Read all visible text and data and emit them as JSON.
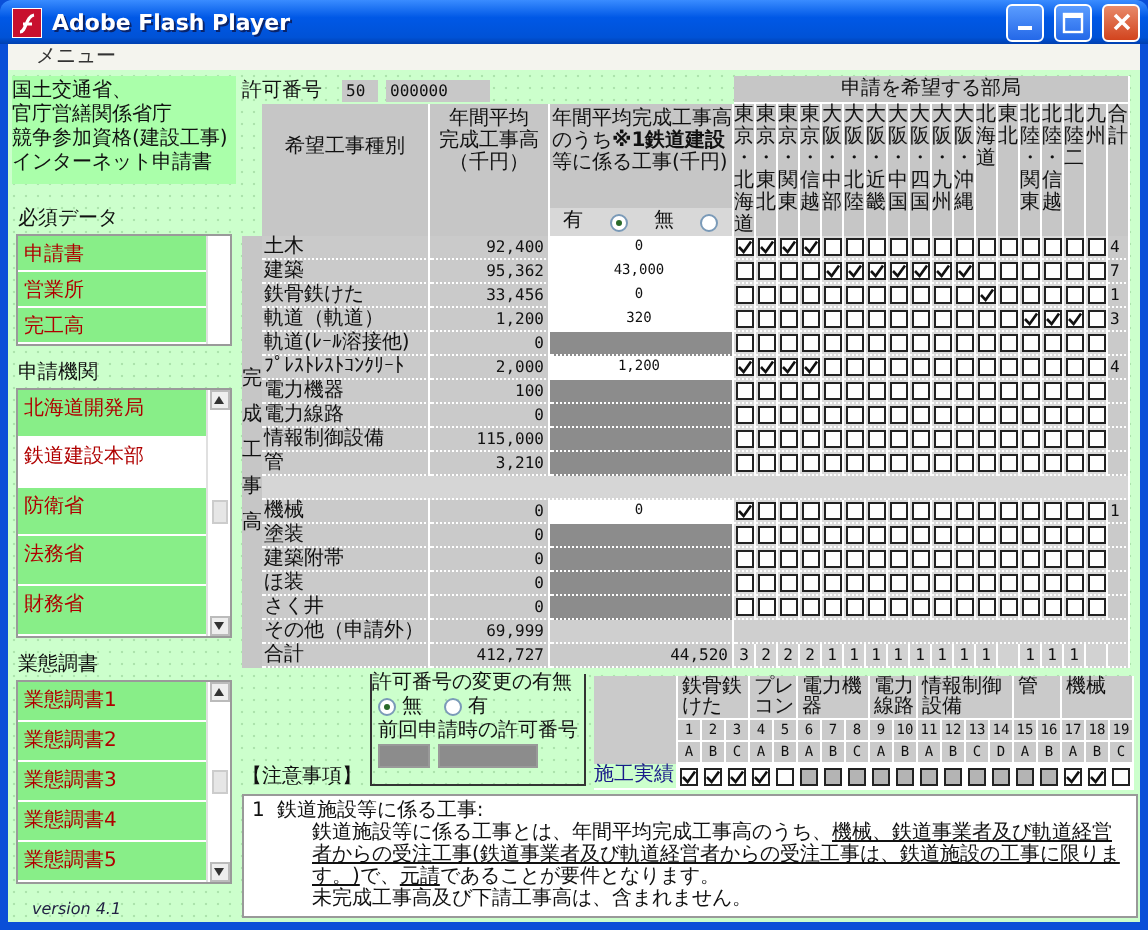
{
  "window": {
    "title": "Adobe Flash Player",
    "menu": [
      "メニュー"
    ]
  },
  "sidebar": {
    "app_title": [
      "国土交通省、",
      "官庁営繕関係省庁",
      "競争参加資格(建設工事)",
      "インターネット申請書"
    ],
    "sections": [
      {
        "heading": "必須データ",
        "scrollbar": false,
        "items": [
          {
            "label": "申請書",
            "selected": false
          },
          {
            "label": "営業所",
            "selected": false
          },
          {
            "label": "完工高",
            "selected": false
          }
        ]
      },
      {
        "heading": "申請機関",
        "scrollbar": true,
        "items": [
          {
            "label": "北海道開発局",
            "selected": false
          },
          {
            "label": "鉄道建設本部",
            "selected": true
          },
          {
            "label": "防衛省",
            "selected": false
          },
          {
            "label": "法務省",
            "selected": false
          },
          {
            "label": "財務省",
            "selected": false
          }
        ]
      },
      {
        "heading": "業態調書",
        "scrollbar": true,
        "items": [
          {
            "label": "業態調書1",
            "selected": false
          },
          {
            "label": "業態調書2",
            "selected": false
          },
          {
            "label": "業態調書3",
            "selected": false
          },
          {
            "label": "業態調書4",
            "selected": false
          },
          {
            "label": "業態調書5",
            "selected": false
          }
        ]
      }
    ],
    "version": "version 4.1"
  },
  "permit": {
    "label": "許可番号",
    "prefix": "50",
    "number": "000000"
  },
  "table": {
    "type_heading": "希望工事種別",
    "average_heading": [
      "年間平均",
      "完成工事高",
      "（千円）"
    ],
    "railway_heading": "年間平均完成工事高のうち**※1鉄道建設**等に係る工事(千円)",
    "railway_options": [
      {
        "label": "有",
        "selected": true
      },
      {
        "label": "無",
        "selected": false
      }
    ],
    "group_label": "完成工事高",
    "departments_heading": "申請を希望する部局",
    "departments": [
      "東京・北海道",
      "東京・東北",
      "東京・関東",
      "東京・信越",
      "大阪・中部",
      "大阪・北陸",
      "大阪・近畿",
      "大阪・中国",
      "大阪・四国",
      "大阪・九州",
      "大阪・沖縄",
      "北海道",
      "東北",
      "北陸・関東",
      "北陸・信越",
      "北陸二",
      "九州"
    ],
    "total_heading": "合計",
    "rows": [
      {
        "kind": "work",
        "type": "土木",
        "average": "92,400",
        "railway_enabled": true,
        "railway": "0",
        "count": "4",
        "checks": [
          true,
          true,
          true,
          true,
          false,
          false,
          false,
          false,
          false,
          false,
          false,
          false,
          false,
          false,
          false,
          false,
          false
        ]
      },
      {
        "kind": "work",
        "type": "建築",
        "average": "95,362",
        "railway_enabled": true,
        "railway": "43,000",
        "count": "7",
        "checks": [
          false,
          false,
          false,
          false,
          true,
          true,
          true,
          true,
          true,
          true,
          true,
          false,
          false,
          false,
          false,
          false,
          false
        ]
      },
      {
        "kind": "work",
        "type": "鉄骨鉄けた",
        "average": "33,456",
        "railway_enabled": true,
        "railway": "0",
        "count": "1",
        "checks": [
          false,
          false,
          false,
          false,
          false,
          false,
          false,
          false,
          false,
          false,
          false,
          true,
          false,
          false,
          false,
          false,
          false
        ]
      },
      {
        "kind": "work",
        "type": "軌道（軌道）",
        "average": "1,200",
        "railway_enabled": true,
        "railway": "320",
        "count": "3",
        "checks": [
          false,
          false,
          false,
          false,
          false,
          false,
          false,
          false,
          false,
          false,
          false,
          false,
          false,
          true,
          true,
          true,
          false
        ]
      },
      {
        "kind": "work",
        "type": "軌道(ﾚｰﾙ溶接他)",
        "average": "0",
        "railway_enabled": false,
        "checks": [
          false,
          false,
          false,
          false,
          false,
          false,
          false,
          false,
          false,
          false,
          false,
          false,
          false,
          false,
          false,
          false,
          false
        ]
      },
      {
        "kind": "work",
        "type": "ﾌﾟﾚｽﾄﾚｽﾄｺﾝｸﾘｰﾄ",
        "average": "2,000",
        "railway_enabled": true,
        "railway": "1,200",
        "count": "4",
        "checks": [
          true,
          true,
          true,
          true,
          false,
          false,
          false,
          false,
          false,
          false,
          false,
          false,
          false,
          false,
          false,
          false,
          false
        ]
      },
      {
        "kind": "work",
        "type": "電力機器",
        "average": "100",
        "railway_enabled": false,
        "checks": [
          false,
          false,
          false,
          false,
          false,
          false,
          false,
          false,
          false,
          false,
          false,
          false,
          false,
          false,
          false,
          false,
          false
        ]
      },
      {
        "kind": "work",
        "type": "電力線路",
        "average": "0",
        "railway_enabled": false,
        "checks": [
          false,
          false,
          false,
          false,
          false,
          false,
          false,
          false,
          false,
          false,
          false,
          false,
          false,
          false,
          false,
          false,
          false
        ]
      },
      {
        "kind": "work",
        "type": "情報制御設備",
        "average": "115,000",
        "railway_enabled": false,
        "checks": [
          false,
          false,
          false,
          false,
          false,
          false,
          false,
          false,
          false,
          false,
          false,
          false,
          false,
          false,
          false,
          false,
          false
        ]
      },
      {
        "kind": "work",
        "type": "管",
        "average": "3,210",
        "railway_enabled": false,
        "checks": [
          false,
          false,
          false,
          false,
          false,
          false,
          false,
          false,
          false,
          false,
          false,
          false,
          false,
          false,
          false,
          false,
          false
        ]
      },
      {
        "kind": "spacer"
      },
      {
        "kind": "work",
        "type": "機械",
        "average": "0",
        "railway_enabled": true,
        "railway": "0",
        "count": "1",
        "checks": [
          true,
          false,
          false,
          false,
          false,
          false,
          false,
          false,
          false,
          false,
          false,
          false,
          false,
          false,
          false,
          false,
          false
        ]
      },
      {
        "kind": "work",
        "type": "塗装",
        "average": "0",
        "railway_enabled": false,
        "checks": [
          false,
          false,
          false,
          false,
          false,
          false,
          false,
          false,
          false,
          false,
          false,
          false,
          false,
          false,
          false,
          false,
          false
        ]
      },
      {
        "kind": "work",
        "type": "建築附帯",
        "average": "0",
        "railway_enabled": false,
        "checks": [
          false,
          false,
          false,
          false,
          false,
          false,
          false,
          false,
          false,
          false,
          false,
          false,
          false,
          false,
          false,
          false,
          false
        ]
      },
      {
        "kind": "work",
        "type": "ほ装",
        "average": "0",
        "railway_enabled": false,
        "checks": [
          false,
          false,
          false,
          false,
          false,
          false,
          false,
          false,
          false,
          false,
          false,
          false,
          false,
          false,
          false,
          false,
          false
        ]
      },
      {
        "kind": "work",
        "type": "さく井",
        "average": "0",
        "railway_enabled": false,
        "checks": [
          false,
          false,
          false,
          false,
          false,
          false,
          false,
          false,
          false,
          false,
          false,
          false,
          false,
          false,
          false,
          false,
          false
        ]
      },
      {
        "kind": "other",
        "type": "その他（申請外）",
        "average": "69,999"
      },
      {
        "kind": "total",
        "type": "合計",
        "average": "412,727",
        "railway": "44,520",
        "counts": [
          {
            "kind": "count",
            "text": "3"
          },
          {
            "kind": "count",
            "text": "2"
          },
          {
            "kind": "count",
            "text": "2"
          },
          {
            "kind": "count",
            "text": "2"
          },
          {
            "kind": "count",
            "text": "1"
          },
          {
            "kind": "count",
            "text": "1"
          },
          {
            "kind": "count",
            "text": "1"
          },
          {
            "kind": "count",
            "text": "1"
          },
          {
            "kind": "count",
            "text": "1"
          },
          {
            "kind": "count",
            "text": "1"
          },
          {
            "kind": "count",
            "text": "1"
          },
          {
            "kind": "count",
            "text": "1"
          },
          {
            "kind": "blank"
          },
          {
            "kind": "count",
            "text": "1"
          },
          {
            "kind": "count",
            "text": "1"
          },
          {
            "kind": "count",
            "text": "1"
          },
          {
            "kind": "blank"
          }
        ]
      }
    ]
  },
  "permit_change": {
    "legend": "許可番号の変更の有無",
    "options": [
      {
        "label": "無",
        "selected": true
      },
      {
        "label": "有",
        "selected": false
      }
    ],
    "previous_label": "前回申請時の許可番号",
    "previous_fields_disabled": true
  },
  "experience": {
    "row_label": "施工実績",
    "groups": [
      {
        "label": "鉄骨鉄けた",
        "columns": [
          {
            "number": "1",
            "letter": "A",
            "checked": true,
            "disabled": false
          },
          {
            "number": "2",
            "letter": "B",
            "checked": true,
            "disabled": false
          },
          {
            "number": "3",
            "letter": "C",
            "checked": true,
            "disabled": false
          }
        ]
      },
      {
        "label": "プレコン",
        "columns": [
          {
            "number": "4",
            "letter": "A",
            "checked": true,
            "disabled": false
          },
          {
            "number": "5",
            "letter": "B",
            "checked": false,
            "disabled": false
          }
        ]
      },
      {
        "label": "電力機器",
        "columns": [
          {
            "number": "6",
            "letter": "A",
            "checked": false,
            "disabled": true
          },
          {
            "number": "7",
            "letter": "B",
            "checked": false,
            "disabled": true
          },
          {
            "number": "8",
            "letter": "C",
            "checked": false,
            "disabled": true
          }
        ]
      },
      {
        "label": "電力線路",
        "columns": [
          {
            "number": "9",
            "letter": "A",
            "checked": false,
            "disabled": true
          },
          {
            "number": "10",
            "letter": "B",
            "checked": false,
            "disabled": true
          }
        ]
      },
      {
        "label": "情報制御設備",
        "columns": [
          {
            "number": "11",
            "letter": "A",
            "checked": false,
            "disabled": true
          },
          {
            "number": "12",
            "letter": "B",
            "checked": false,
            "disabled": true
          },
          {
            "number": "13",
            "letter": "C",
            "checked": false,
            "disabled": true
          },
          {
            "number": "14",
            "letter": "D",
            "checked": false,
            "disabled": true
          }
        ]
      },
      {
        "label": "管",
        "columns": [
          {
            "number": "15",
            "letter": "A",
            "checked": false,
            "disabled": true
          },
          {
            "number": "16",
            "letter": "B",
            "checked": false,
            "disabled": true
          }
        ]
      },
      {
        "label": "機械",
        "columns": [
          {
            "number": "17",
            "letter": "A",
            "checked": true,
            "disabled": false
          },
          {
            "number": "18",
            "letter": "B",
            "checked": true,
            "disabled": false
          },
          {
            "number": "19",
            "letter": "C",
            "checked": false,
            "disabled": false
          }
        ]
      }
    ]
  },
  "notes": {
    "heading": "【注意事項】",
    "items": [
      {
        "number": "1",
        "title": "鉄道施設等に係る工事:",
        "paragraphs": [
          [
            {
              "text": "鉄道施設等に係る工事とは、年間平均完成工事高のうち、",
              "underline": false
            },
            {
              "text": "機械、鉄道事業者及び軌道経営者からの受注工事(鉄道事業者及び軌道経営者からの受注工事は、鉄道施設の工事に限ります。)",
              "underline": true
            },
            {
              "text": "で、",
              "underline": false
            },
            {
              "text": "元請",
              "underline": true
            },
            {
              "text": "であることが要件となります。",
              "underline": false
            }
          ],
          [
            {
              "text": "未完成工事高及び下請工事高は、含まれません。",
              "underline": false
            }
          ]
        ]
      }
    ]
  }
}
